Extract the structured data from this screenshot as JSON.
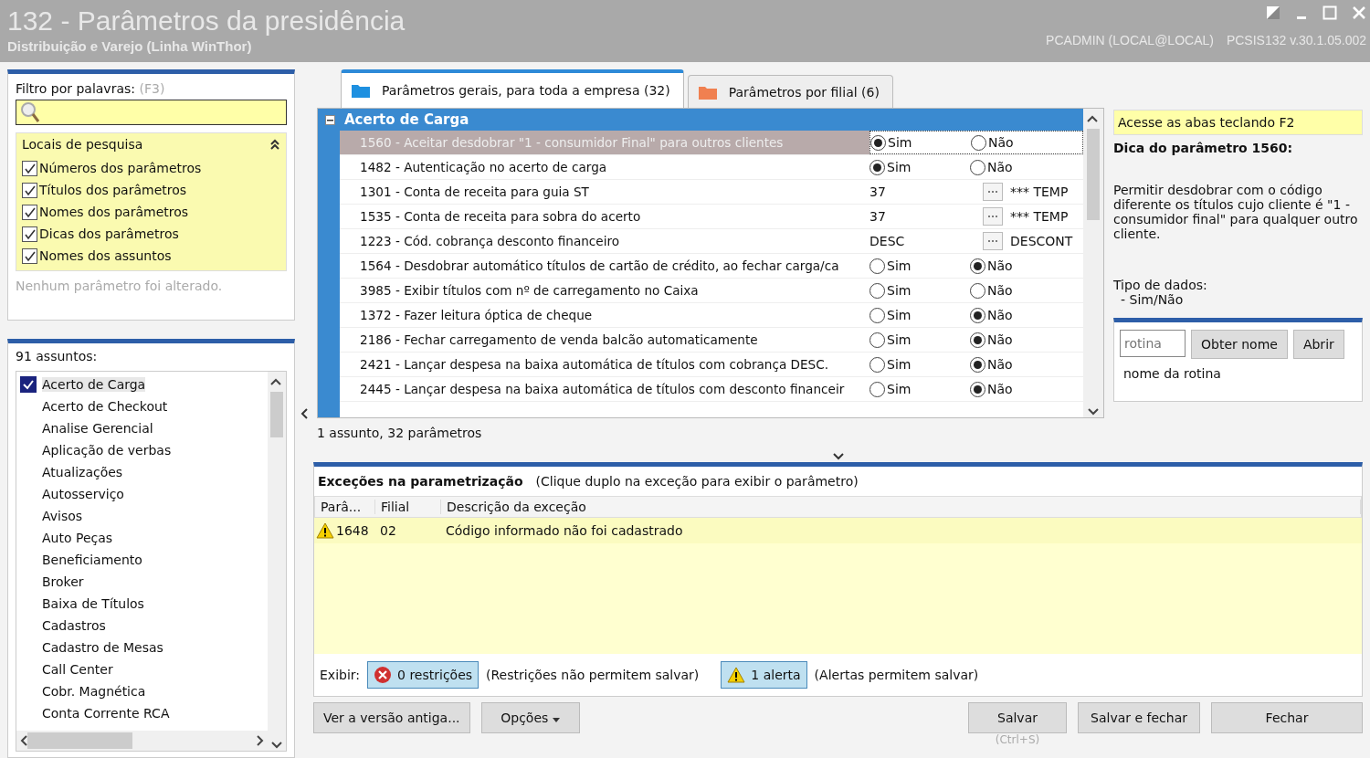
{
  "window": {
    "title": "132 - Parâmetros da presidência",
    "subtitle": "Distribuição e Varejo (Linha WinThor)",
    "user_info": "PCADMIN (LOCAL@LOCAL)",
    "version": "PCSIS132  v.30.1.05.002"
  },
  "filter": {
    "label": "Filtro por palavras:",
    "shortcut": "(F3)",
    "search_places": {
      "title": "Locais de pesquisa",
      "expanded": true,
      "options": [
        {
          "label": "Números dos parâmetros",
          "checked": true
        },
        {
          "label": "Títulos dos parâmetros",
          "checked": true
        },
        {
          "label": "Nomes dos parâmetros",
          "checked": true
        },
        {
          "label": "Dicas dos parâmetros",
          "checked": true
        },
        {
          "label": "Nomes dos assuntos",
          "checked": true
        }
      ]
    },
    "status": "Nenhum parâmetro foi alterado."
  },
  "subjects": {
    "count_label": "91 assuntos:",
    "items": [
      {
        "label": "Acerto de Carga",
        "checked": true
      },
      {
        "label": "Acerto de Checkout",
        "checked": false
      },
      {
        "label": "Analise Gerencial",
        "checked": false
      },
      {
        "label": "Aplicação de verbas",
        "checked": false
      },
      {
        "label": "Atualizações",
        "checked": false
      },
      {
        "label": "Autosserviço",
        "checked": false
      },
      {
        "label": "Avisos",
        "checked": false
      },
      {
        "label": "Auto Peças",
        "checked": false
      },
      {
        "label": "Beneficiamento",
        "checked": false
      },
      {
        "label": "Broker",
        "checked": false
      },
      {
        "label": "Baixa de Títulos",
        "checked": false
      },
      {
        "label": "Cadastros",
        "checked": false
      },
      {
        "label": "Cadastro de Mesas",
        "checked": false
      },
      {
        "label": "Call Center",
        "checked": false
      },
      {
        "label": "Cobr. Magnética",
        "checked": false
      },
      {
        "label": "Conta Corrente RCA",
        "checked": false
      }
    ]
  },
  "tabs": [
    {
      "label": "Parâmetros gerais, para toda a empresa  (32)",
      "selected": true,
      "color": "#1e90e0"
    },
    {
      "label": "Parâmetros por filial  (6)",
      "selected": false,
      "color": "#f08050"
    }
  ],
  "parameters": {
    "group": "Acerto de Carga",
    "expanded": true,
    "rows": [
      {
        "title": "1560 - Aceitar desdobrar \"1 - consumidor Final\" para outros clientes",
        "selected": true,
        "kind": "bool",
        "options": [
          {
            "label": "Sim",
            "selected": true
          },
          {
            "label": "Não",
            "selected": false
          }
        ]
      },
      {
        "title": "1482 - Autenticação no acerto de carga",
        "selected": false,
        "kind": "bool",
        "options": [
          {
            "label": "Sim",
            "selected": true
          },
          {
            "label": "Não",
            "selected": false
          }
        ]
      },
      {
        "title": "1301 - Conta de receita para guia ST",
        "selected": false,
        "kind": "lookup",
        "value": "37",
        "description": "*** TEMP"
      },
      {
        "title": "1535 - Conta de receita para sobra do acerto",
        "selected": false,
        "kind": "lookup",
        "value": "37",
        "description": "*** TEMP"
      },
      {
        "title": "1223 - Cód. cobrança desconto financeiro",
        "selected": false,
        "kind": "lookup",
        "value": "DESC",
        "description": "DESCONT"
      },
      {
        "title": "1564 - Desdobrar automático títulos de cartão de crédito, ao fechar carga/ca",
        "selected": false,
        "kind": "bool",
        "options": [
          {
            "label": "Sim",
            "selected": false
          },
          {
            "label": "Não",
            "selected": true
          }
        ]
      },
      {
        "title": "3985 - Exibir títulos com nº de carregamento no Caixa",
        "selected": false,
        "kind": "bool",
        "options": [
          {
            "label": "Sim",
            "selected": false
          },
          {
            "label": "Não",
            "selected": false
          }
        ]
      },
      {
        "title": "1372 - Fazer leitura óptica de cheque",
        "selected": false,
        "kind": "bool",
        "options": [
          {
            "label": "Sim",
            "selected": false
          },
          {
            "label": "Não",
            "selected": true
          }
        ]
      },
      {
        "title": "2186 - Fechar carregamento de venda balcão automaticamente",
        "selected": false,
        "kind": "bool",
        "options": [
          {
            "label": "Sim",
            "selected": false
          },
          {
            "label": "Não",
            "selected": true
          }
        ]
      },
      {
        "title": "2421 - Lançar despesa na baixa automática de títulos com cobrança DESC.",
        "selected": false,
        "kind": "bool",
        "options": [
          {
            "label": "Sim",
            "selected": false
          },
          {
            "label": "Não",
            "selected": true
          }
        ]
      },
      {
        "title": "2445 - Lançar despesa na baixa automática de títulos com desconto financeir",
        "selected": false,
        "kind": "bool",
        "options": [
          {
            "label": "Sim",
            "selected": false
          },
          {
            "label": "Não",
            "selected": true
          }
        ]
      }
    ],
    "summary": "1 assunto, 32 parâmetros"
  },
  "hint_panel": {
    "banner": "Acesse as abas teclando F2",
    "title": "Dica do parâmetro 1560:",
    "text": "Permitir desdobrar com o código diferente os títulos cujo cliente é \"1 - consumidor final\" para qualquer outro cliente.",
    "data_type_label": "Tipo de dados:",
    "data_type": "- Sim/Não",
    "routine_placeholder": "rotina",
    "get_name_button": "Obter nome",
    "open_button": "Abrir",
    "routine_name": "nome da rotina"
  },
  "exceptions": {
    "title": "Exceções na parametrização",
    "hint": "(Clique duplo na exceção para exibir o parâmetro)",
    "columns": [
      "Parâ...",
      "Filial",
      "Descrição da exceção"
    ],
    "rows": [
      {
        "kind": "alert",
        "param": "1648",
        "branch": "02",
        "description": "Código informado não foi cadastrado"
      }
    ],
    "show_label": "Exibir:",
    "restrictions_button": "0 restrições",
    "restrictions_note": "(Restrições não permitem salvar)",
    "alerts_button": "1 alerta",
    "alerts_note": "(Alertas permitem salvar)"
  },
  "footer": {
    "old_version_button": "Ver a versão antiga...",
    "options_button": "Opções",
    "save_button": "Salvar",
    "save_shortcut": "(Ctrl+S)",
    "save_close_button": "Salvar e fechar",
    "close_button": "Fechar"
  }
}
